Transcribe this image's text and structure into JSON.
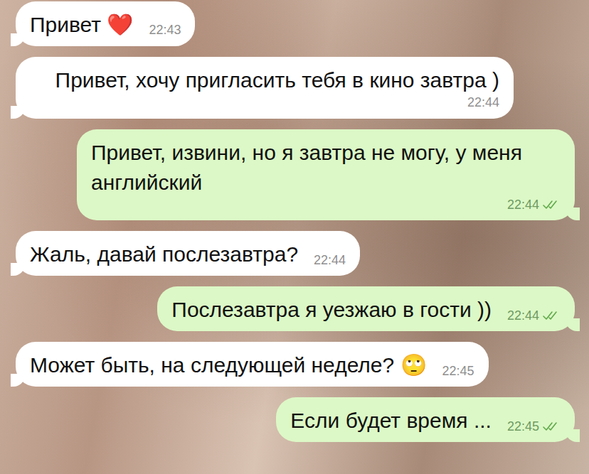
{
  "chat": {
    "messages": [
      {
        "text": "Привет ❤️",
        "time": "22:43",
        "kind": "incoming",
        "read": false
      },
      {
        "text": "Привет, хочу пригласить тебя в кино завтра )",
        "time": "22:44",
        "kind": "incoming",
        "read": false
      },
      {
        "text": "Привет, извини, но я завтра не могу, у меня английский",
        "time": "22:44",
        "kind": "outgoing",
        "read": true
      },
      {
        "text": "Жаль, давай послезавтра?",
        "time": "22:44",
        "kind": "incoming",
        "read": false
      },
      {
        "text": "Послезавтра я уезжаю в гости ))",
        "time": "22:44",
        "kind": "outgoing",
        "read": true
      },
      {
        "text": "Может быть, на следующей неделе? 🙄",
        "time": "22:45",
        "kind": "incoming",
        "read": false
      },
      {
        "text": "Если будет время ...",
        "time": "22:45",
        "kind": "outgoing",
        "read": true
      }
    ]
  }
}
